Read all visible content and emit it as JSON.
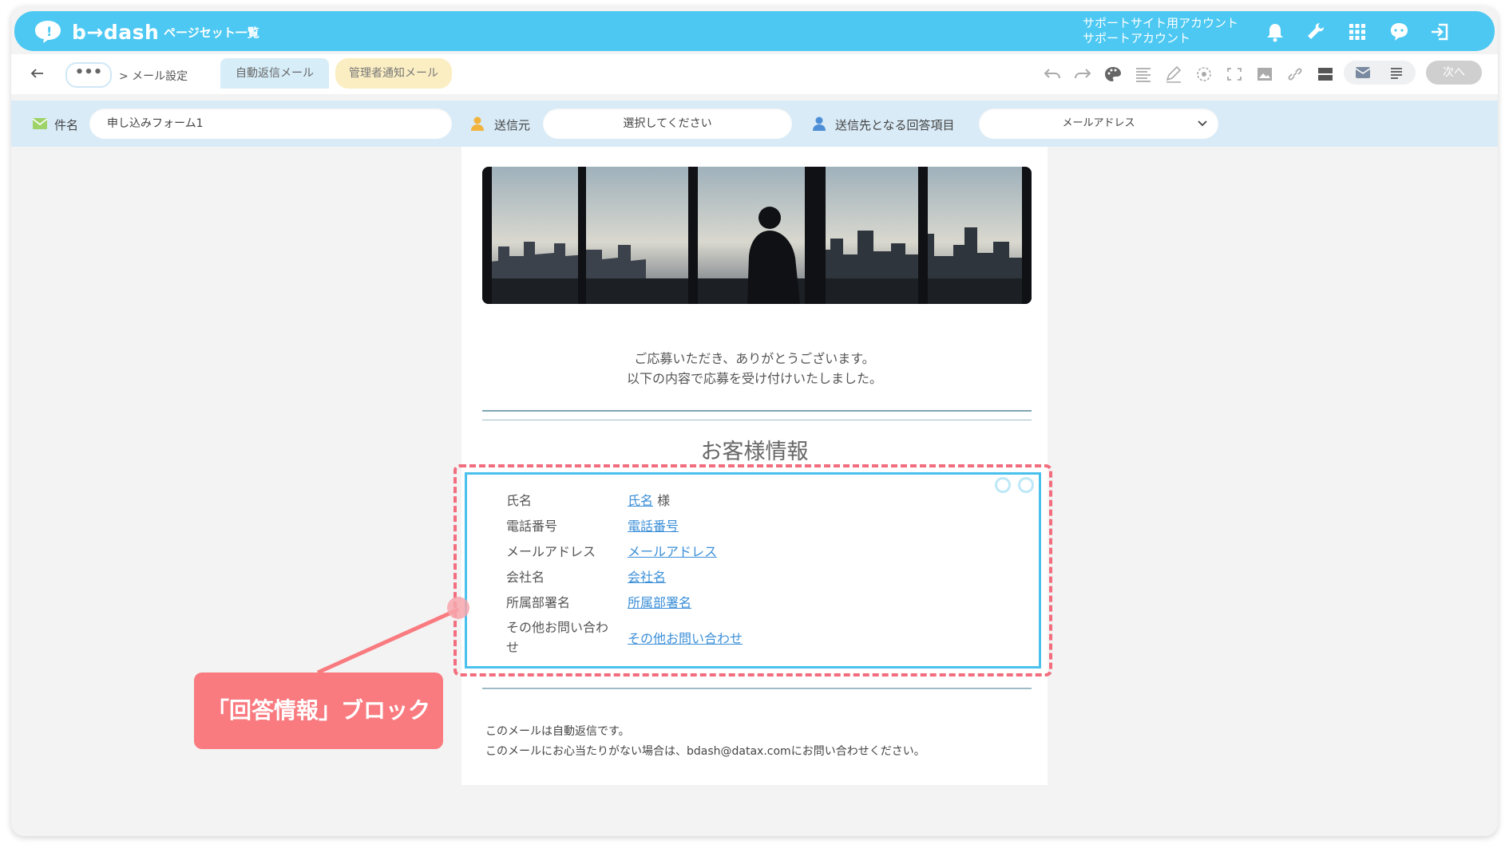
{
  "app": {
    "logo_text": "b→dash",
    "page_title": "ページセット一覧",
    "account_line1": "サポートサイト用アカウント",
    "account_line2": "サポートアカウント"
  },
  "nav": {
    "more": "•••",
    "breadcrumb": "> メール設定",
    "tabs": [
      {
        "label": "自動返信メール",
        "active": true
      },
      {
        "label": "管理者通知メール",
        "active": false
      }
    ],
    "next_label": "次へ"
  },
  "settings": {
    "subject_label": "件名",
    "subject_value": "申し込みフォーム1",
    "sender_label": "送信元",
    "sender_placeholder": "選択してください",
    "recipient_label": "送信先となる回答項目",
    "recipient_value": "メールアドレス"
  },
  "email": {
    "greeting_line1": "ご応募いただき、ありがとうございます。",
    "greeting_line2": "以下の内容で応募を受け付けいたしました。",
    "section_title": "お客様情報",
    "fields": [
      {
        "label": "氏名",
        "value": "氏名",
        "suffix": " 様"
      },
      {
        "label": "電話番号",
        "value": "電話番号",
        "suffix": ""
      },
      {
        "label": "メールアドレス",
        "value": "メールアドレス",
        "suffix": ""
      },
      {
        "label": "会社名",
        "value": "会社名",
        "suffix": ""
      },
      {
        "label": "所属部署名",
        "value": "所属部署名",
        "suffix": ""
      },
      {
        "label": "その他お問い合わせ",
        "value": "その他お問い合わせ",
        "suffix": ""
      }
    ],
    "footer_line1": "このメールは自動返信です。",
    "footer_line2": "このメールにお心当たりがない場合は、bdash@datax.comにお問い合わせください。"
  },
  "annotation": {
    "label": "「回答情報」ブロック"
  },
  "colors": {
    "brand_blue": "#4cc8f2",
    "annotation_red": "#f97b80",
    "selection_blue": "#49c1ec",
    "link_blue": "#3b8fd8"
  }
}
